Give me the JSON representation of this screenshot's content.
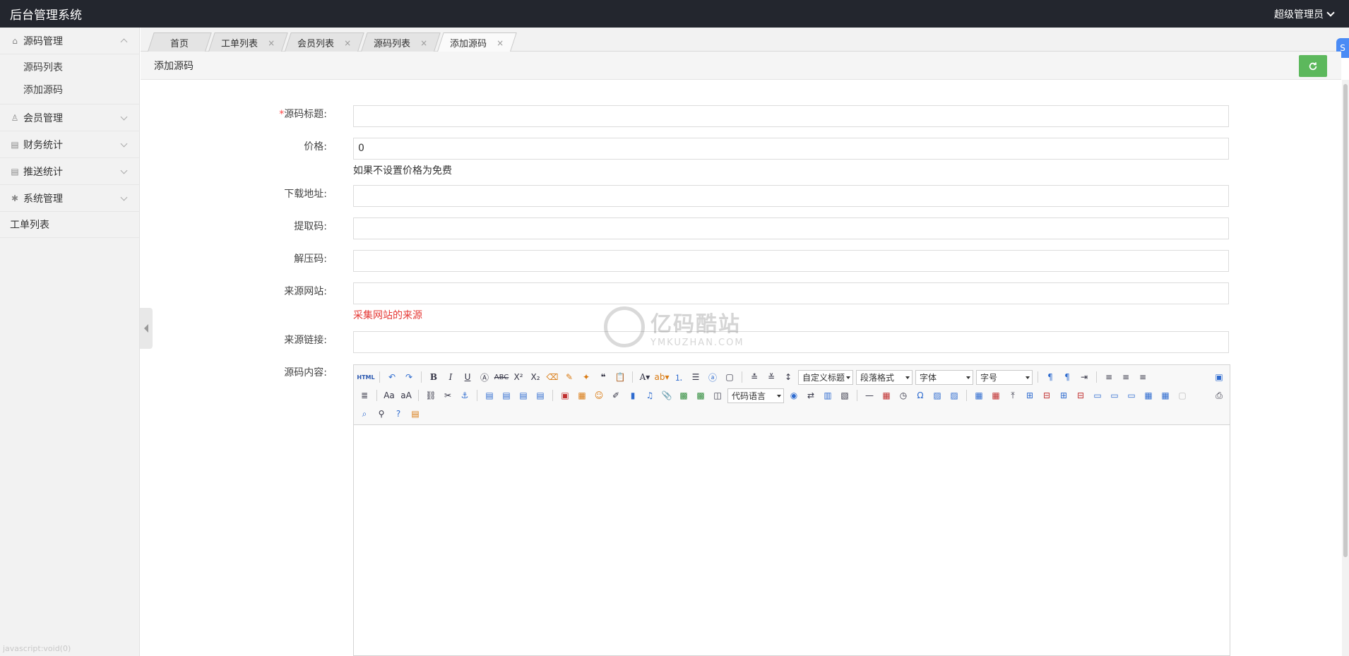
{
  "header": {
    "title": "后台管理系统",
    "user": "超级管理员"
  },
  "sidebar": {
    "groups": [
      {
        "label": "源码管理",
        "icon": "home-icon",
        "expanded": true,
        "items": [
          "源码列表",
          "添加源码"
        ]
      },
      {
        "label": "会员管理",
        "icon": "user-icon",
        "expanded": false
      },
      {
        "label": "财务统计",
        "icon": "chart-icon",
        "expanded": false
      },
      {
        "label": "推送统计",
        "icon": "chart-icon",
        "expanded": false
      },
      {
        "label": "系统管理",
        "icon": "gear-icon",
        "expanded": false
      }
    ],
    "plain_item": "工单列表",
    "status_hint": "javascript:void(0)"
  },
  "tabs": [
    {
      "label": "首页",
      "closable": false
    },
    {
      "label": "工单列表",
      "closable": true
    },
    {
      "label": "会员列表",
      "closable": true
    },
    {
      "label": "源码列表",
      "closable": true
    },
    {
      "label": "添加源码",
      "closable": true,
      "active": true
    }
  ],
  "tab_close_glyph": "×",
  "page": {
    "title": "添加源码"
  },
  "form": {
    "title_label": "源码标题:",
    "title_required_mark": "*",
    "price_label": "价格:",
    "price_value": "0",
    "price_help": "如果不设置价格为免费",
    "download_label": "下载地址:",
    "extract_label": "提取码:",
    "unzip_label": "解压码:",
    "source_site_label": "来源网站:",
    "source_site_help": "采集网站的来源",
    "source_link_label": "来源链接:",
    "content_label": "源码内容:"
  },
  "editor": {
    "html_button": "HTML",
    "selects": {
      "custom_heading": "自定义标题",
      "paragraph": "段落格式",
      "font": "字体",
      "size": "字号",
      "code_lang": "代码语言"
    }
  },
  "watermark": {
    "brand": "亿码酷站",
    "url": "YMKUZHAN.COM"
  },
  "colors": {
    "topbar": "#23262e",
    "refresh_button": "#5cb85c",
    "required": "#ff4444",
    "help_red": "#e53935"
  }
}
